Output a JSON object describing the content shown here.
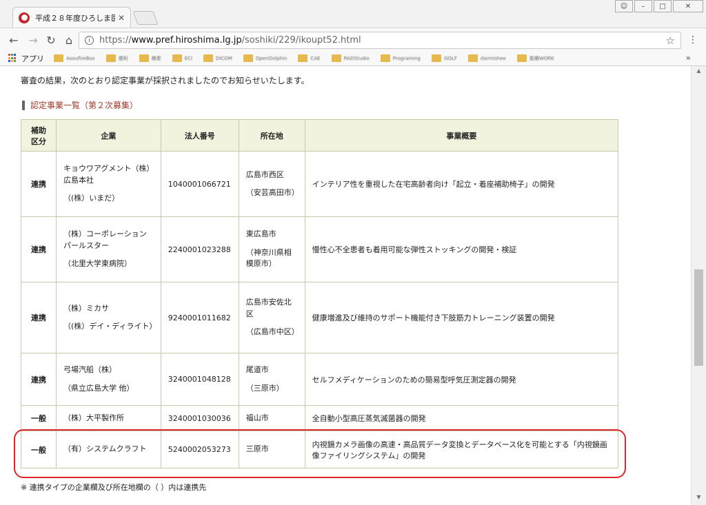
{
  "browser": {
    "tab_title": "平成２８年度ひろしま医",
    "url_scheme": "https://",
    "url_host": "www.pref.hiroshima.lg.jp",
    "url_path": "/soshiki/229/ikoupt52.html",
    "apps_label": "アプリ",
    "bookmarks": [
      "AsoufireBox",
      "便利",
      "検索",
      "ECI",
      "DICOM",
      "OpenDolphin",
      "CAE",
      "RADStudio",
      "Programing",
      "GOLF",
      "darmishee",
      "医療WORK"
    ]
  },
  "page": {
    "intro": "審査の結果，次のとおり認定事業が採択されましたのでお知らせいたします。",
    "heading": "認定事業一覧（第２次募集）",
    "table": {
      "headers": [
        "補助区分",
        "企業",
        "法人番号",
        "所在地",
        "事業概要"
      ],
      "rows": [
        {
          "type": "連携",
          "company": "キョウワアグメント（株）広島本社",
          "partner": "（(株）いまだ）",
          "number": "1040001066721",
          "location": "広島市西区",
          "location_partner": "（安芸高田市）",
          "summary": "インテリア性を重視した在宅高齢者向け「起立・着座補助椅子」の開発"
        },
        {
          "type": "連携",
          "company": "（株）コーポレーションパールスター",
          "partner": "（北里大学東病院）",
          "number": "2240001023288",
          "location": "東広島市",
          "location_partner": "（神奈川県相模原市）",
          "summary": "慢性心不全患者も着用可能な弾性ストッキングの開発・検証"
        },
        {
          "type": "連携",
          "company": "（株）ミカサ",
          "partner": "（(株）デイ・ディライト）",
          "number": "9240001011682",
          "location": "広島市安佐北区",
          "location_partner": "（広島市中区）",
          "summary": "健康増進及び維持のサポート機能付き下肢筋力トレーニング装置の開発"
        },
        {
          "type": "連携",
          "company": "弓場汽船（株）",
          "partner": "（県立広島大学 他）",
          "number": "3240001048128",
          "location": "尾道市",
          "location_partner": "（三原市）",
          "summary": "セルフメディケーションのための簡易型呼気圧測定器の開発"
        },
        {
          "type": "一般",
          "company": "（株）大平製作所",
          "partner": "",
          "number": "3240001030036",
          "location": "福山市",
          "location_partner": "",
          "summary": "全自動小型高圧蒸気滅菌器の開発"
        },
        {
          "type": "一般",
          "company": "（有）システムクラフト",
          "partner": "",
          "number": "5240002053273",
          "location": "三原市",
          "location_partner": "",
          "summary": "内視鏡カメラ画像の高速・高品質データ変換とデータベース化を可能とする「内視鏡画像ファイリングシステム」の開発"
        }
      ]
    },
    "footnote": "※ 連携タイプの企業欄及び所在地欄の（ ）内は連携先"
  }
}
